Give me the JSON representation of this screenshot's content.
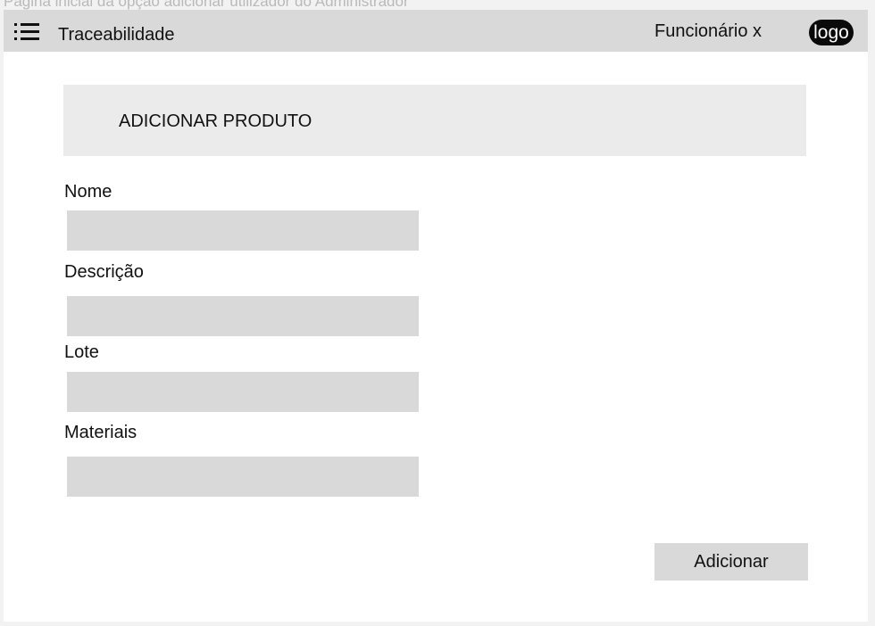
{
  "caption": "Página inicial da opção adicionar utilizador do Administrador",
  "header": {
    "app_title": "Traceabilidade",
    "user_label": "Funcionário x",
    "logo_text": "logo",
    "menu_icon": "list-menu-icon"
  },
  "form": {
    "title": "ADICIONAR PRODUTO",
    "fields": [
      {
        "label": "Nome",
        "value": ""
      },
      {
        "label": "Descrição",
        "value": ""
      },
      {
        "label": "Lote",
        "value": ""
      },
      {
        "label": "Materiais",
        "value": ""
      }
    ],
    "submit_label": "Adicionar"
  },
  "colors": {
    "page_background": "#f2f2f2",
    "panel": "#ffffff",
    "bar": "#d9d9d9",
    "section_header": "#ebebeb",
    "input": "#d9d9d9",
    "logo_background": "#0a0a0a"
  }
}
